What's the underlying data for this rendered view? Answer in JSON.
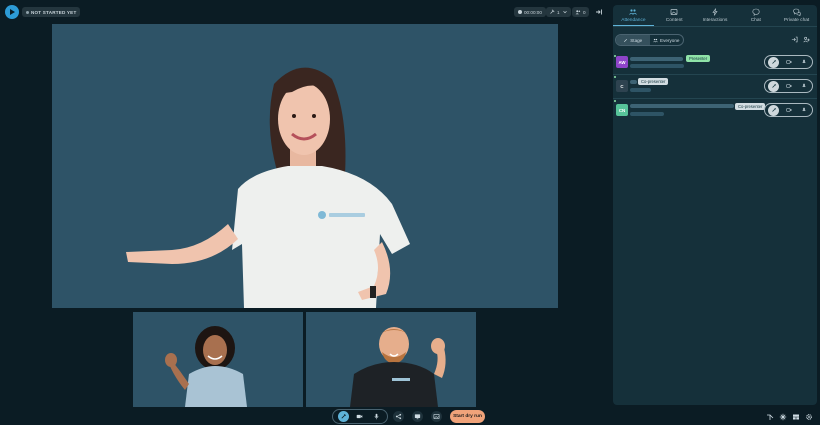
{
  "top_bar": {
    "logo_icon": "play-logo-icon",
    "status_label": "NOT STARTED YET",
    "timer": "00:00:00",
    "pin_count": "1",
    "attendee_count": "0"
  },
  "stage": {
    "main_presenter_icon": "presenter-video",
    "thumbnails": [
      "co-presenter-video-1",
      "co-presenter-video-2"
    ]
  },
  "controls": {
    "dry_run_label": "Start dry run",
    "icons": [
      "pen-icon",
      "camera-icon",
      "mic-icon",
      "share-icon",
      "screen-icon",
      "image-icon"
    ]
  },
  "panel": {
    "tabs": [
      {
        "label": "Attendance",
        "icon": "people-icon",
        "active": true
      },
      {
        "label": "Content",
        "icon": "image-icon",
        "active": false
      },
      {
        "label": "Interactions",
        "icon": "lightning-icon",
        "active": false
      },
      {
        "label": "Chat",
        "icon": "chat-icon",
        "active": false
      },
      {
        "label": "Private chat",
        "icon": "private-chat-icon",
        "active": false
      }
    ],
    "segments": [
      {
        "label": "Stage",
        "active": true
      },
      {
        "label": "Everyone",
        "active": false
      }
    ],
    "rows": [
      {
        "initials": "AW",
        "avatar_color": "#8e44c9",
        "role": "Presenter"
      },
      {
        "initials": "C",
        "avatar_color": "#2e4350",
        "role": "Co-presenter"
      },
      {
        "initials": "CN",
        "avatar_color": "#57c49a",
        "role": "Co-presenter"
      }
    ]
  },
  "colors": {
    "accent": "#5fb3d8",
    "dry_run": "#f0a37a",
    "presenter_badge": "#8fe3a8",
    "stage_bg": "#2e5367"
  }
}
